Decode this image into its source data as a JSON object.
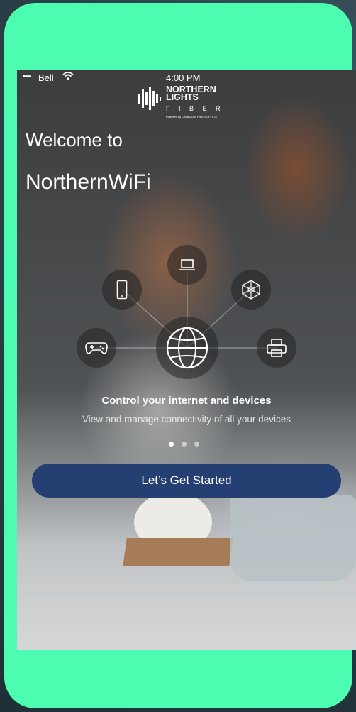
{
  "status_bar": {
    "signal": "••••",
    "carrier": "Bell",
    "wifi_icon": "wifi-icon",
    "time": "4:00 PM"
  },
  "logo": {
    "line1": "NORTHERN",
    "line2": "LIGHTS",
    "line3": "F I B E R",
    "tagline": "Powered by CANADIAN FIBER OPTICS"
  },
  "hero": {
    "welcome": "Welcome to",
    "app_name": "NorthernWiFi"
  },
  "device_hub": {
    "center_icon": "globe-icon",
    "devices": [
      "laptop-icon",
      "phone-icon",
      "network-icon",
      "gamepad-icon",
      "printer-icon"
    ]
  },
  "slide": {
    "title": "Control your internet and devices",
    "subtitle": "View and manage connectivity of all your devices",
    "pages": 3,
    "active_page": 1
  },
  "cta": {
    "label": "Let’s Get Started"
  },
  "colors": {
    "frame": "#4cfcb0",
    "button": "#253f72",
    "background": "#2b3f48"
  }
}
